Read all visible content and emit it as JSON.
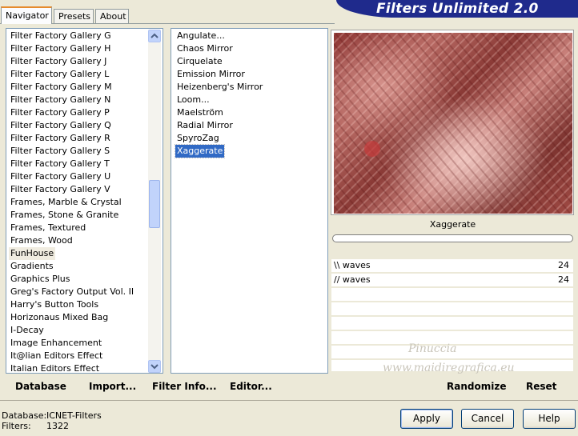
{
  "tabs": [
    "Navigator",
    "Presets",
    "About"
  ],
  "banner_title": "Filters Unlimited 2.0",
  "categories": [
    "Filter Factory Gallery G",
    "Filter Factory Gallery H",
    "Filter Factory Gallery J",
    "Filter Factory Gallery L",
    "Filter Factory Gallery M",
    "Filter Factory Gallery N",
    "Filter Factory Gallery P",
    "Filter Factory Gallery Q",
    "Filter Factory Gallery R",
    "Filter Factory Gallery S",
    "Filter Factory Gallery T",
    "Filter Factory Gallery U",
    "Filter Factory Gallery V",
    "Frames, Marble & Crystal",
    "Frames, Stone & Granite",
    "Frames, Textured",
    "Frames, Wood",
    "FunHouse",
    "Gradients",
    "Graphics Plus",
    "Greg's Factory Output Vol. II",
    "Harry's Button Tools",
    "Horizonaus Mixed Bag",
    "I-Decay",
    "Image Enhancement",
    "It@lian Editors Effect",
    "Italian Editors Effect"
  ],
  "selected_category": "FunHouse",
  "filters": [
    "Angulate...",
    "Chaos Mirror",
    "Cirquelate",
    "Emission Mirror",
    "Heizenberg's Mirror",
    "Loom...",
    "Maelström",
    "Radial Mirror",
    "SpyroZag",
    "Xaggerate"
  ],
  "selected_filter": "Xaggerate",
  "filter_name": "Xaggerate",
  "params": [
    {
      "name": "\\\\ waves",
      "value": "24"
    },
    {
      "name": "// waves",
      "value": "24"
    }
  ],
  "links": {
    "database": "Database",
    "import": "Import...",
    "filter_info": "Filter Info...",
    "editor": "Editor...",
    "randomize": "Randomize",
    "reset": "Reset"
  },
  "status": {
    "database_label": "Database:",
    "database_value": "ICNET-Filters",
    "filters_label": "Filters:",
    "filters_value": "1322"
  },
  "buttons": {
    "apply": "Apply",
    "cancel": "Cancel",
    "help": "Help"
  },
  "watermark": {
    "line1": "Pinuccia",
    "line2": "www.maidiregrafica.eu"
  }
}
